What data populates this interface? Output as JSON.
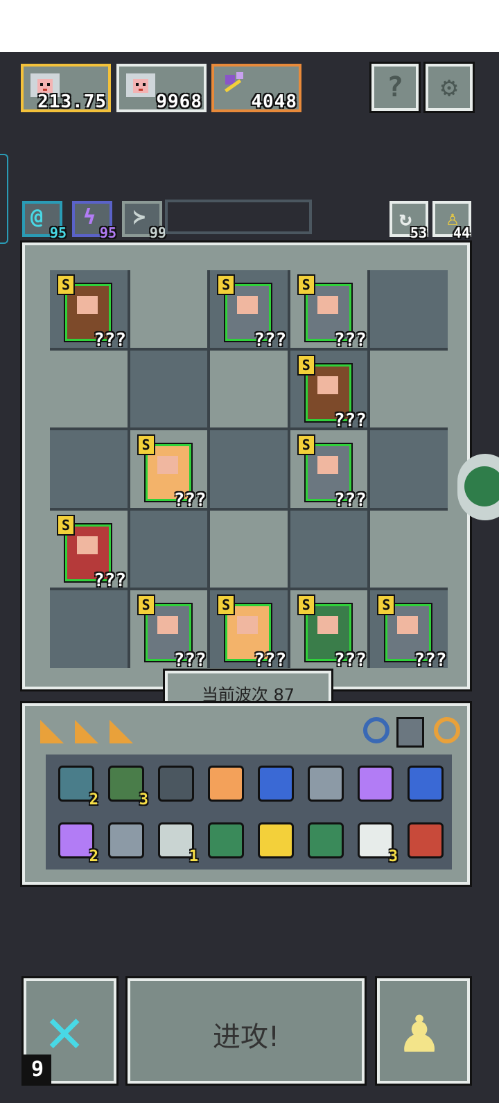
{
  "top_cards": [
    {
      "name": "hero-card-1",
      "value": "213.75",
      "border": "#f3c13a"
    },
    {
      "name": "hero-card-2",
      "value": "9968",
      "border": "#e7ecea"
    },
    {
      "name": "weapon-card",
      "value": "4048",
      "border": "#e88a3a"
    }
  ],
  "top_buttons": {
    "help": "?",
    "settings": "⚙"
  },
  "resources": [
    {
      "name": "res-cyan",
      "value": "95",
      "border": "#2a9bb5",
      "color": "#48d9e6",
      "glyph": "@"
    },
    {
      "name": "res-purple",
      "value": "95",
      "border": "#5a62c8",
      "color": "#b27cf5",
      "glyph": "ϟ"
    },
    {
      "name": "res-gray",
      "value": "99",
      "border": "#8c9a96",
      "color": "#c9d4d2",
      "glyph": "≻"
    }
  ],
  "right_counters": [
    {
      "name": "refresh-counter",
      "value": "53"
    },
    {
      "name": "key-counter",
      "value": "44"
    }
  ],
  "board": {
    "rank": "S",
    "unknown": "???",
    "units": [
      {
        "row": 0,
        "col": 0,
        "kind": "shield"
      },
      {
        "row": 0,
        "col": 2,
        "kind": "spear"
      },
      {
        "row": 0,
        "col": 3,
        "kind": "spear"
      },
      {
        "row": 1,
        "col": 3,
        "kind": "shield"
      },
      {
        "row": 2,
        "col": 1,
        "kind": "barbarian"
      },
      {
        "row": 2,
        "col": 3,
        "kind": "spear"
      },
      {
        "row": 3,
        "col": 0,
        "kind": "dwarf"
      },
      {
        "row": 4,
        "col": 1,
        "kind": "spear"
      },
      {
        "row": 4,
        "col": 2,
        "kind": "monk"
      },
      {
        "row": 4,
        "col": 3,
        "kind": "archer"
      },
      {
        "row": 4,
        "col": 4,
        "kind": "spear"
      }
    ]
  },
  "wave_label": "当前波次 87",
  "inventory": {
    "row1": [
      {
        "name": "heart-gem-icon",
        "count": "2"
      },
      {
        "name": "hood-icon",
        "count": "3"
      },
      {
        "name": "shield-icon",
        "count": ""
      },
      {
        "name": "key-icon",
        "count": ""
      },
      {
        "name": "water-drop-icon",
        "count": ""
      },
      {
        "name": "boot-icon",
        "count": ""
      },
      {
        "name": "purple-key-icon",
        "count": ""
      },
      {
        "name": "blue-flame-icon",
        "count": ""
      }
    ],
    "row2": [
      {
        "name": "potion-icon",
        "count": "2"
      },
      {
        "name": "shuriken-icon",
        "count": ""
      },
      {
        "name": "bow-icon",
        "count": "1"
      },
      {
        "name": "green-rune-icon",
        "count": ""
      },
      {
        "name": "goblet-icon",
        "count": ""
      },
      {
        "name": "red-rune-icon",
        "count": ""
      },
      {
        "name": "claw-icon",
        "count": "3"
      },
      {
        "name": "arrow-icon",
        "count": ""
      }
    ]
  },
  "bottom": {
    "left_count": "9",
    "attack_label": "进攻!"
  }
}
